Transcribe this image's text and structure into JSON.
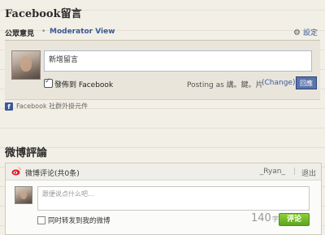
{
  "facebook_section": {
    "title": "Facebook留言",
    "tabs": {
      "public_label": "公眾意見",
      "separator": "•",
      "moderator_label": "Moderator View"
    },
    "settings_label": "設定",
    "comment_placeholder": "新增留言",
    "post_to_facebook_label": "發佈到 Facebook",
    "post_to_facebook_checked": true,
    "posting_as_label": "Posting as 講。鍵。片",
    "change_link": "(Change)",
    "comment_button_label": "回應",
    "plugin_label": "Facebook 社群外掛元件"
  },
  "weibo_section": {
    "title": "微博評論",
    "header_title": "微博评论(共0条)",
    "username": "_Ryan_",
    "separator": "|",
    "logout_label": "退出",
    "textarea_placeholder": "跟便说点什么吧...",
    "repost_label": "同时转发到我的微博",
    "repost_checked": false,
    "char_count": "140",
    "char_unit": "字",
    "submit_label": "评论"
  },
  "colors": {
    "facebook_blue": "#3b5998",
    "weibo_green": "#6db528",
    "weibo_red": "#e6162d",
    "page_background": "#f2efe6"
  },
  "icons": {
    "settings": "gear-icon",
    "facebook": "facebook-logo-icon",
    "weibo": "weibo-logo-icon",
    "checkbox": "checkbox-icon"
  }
}
